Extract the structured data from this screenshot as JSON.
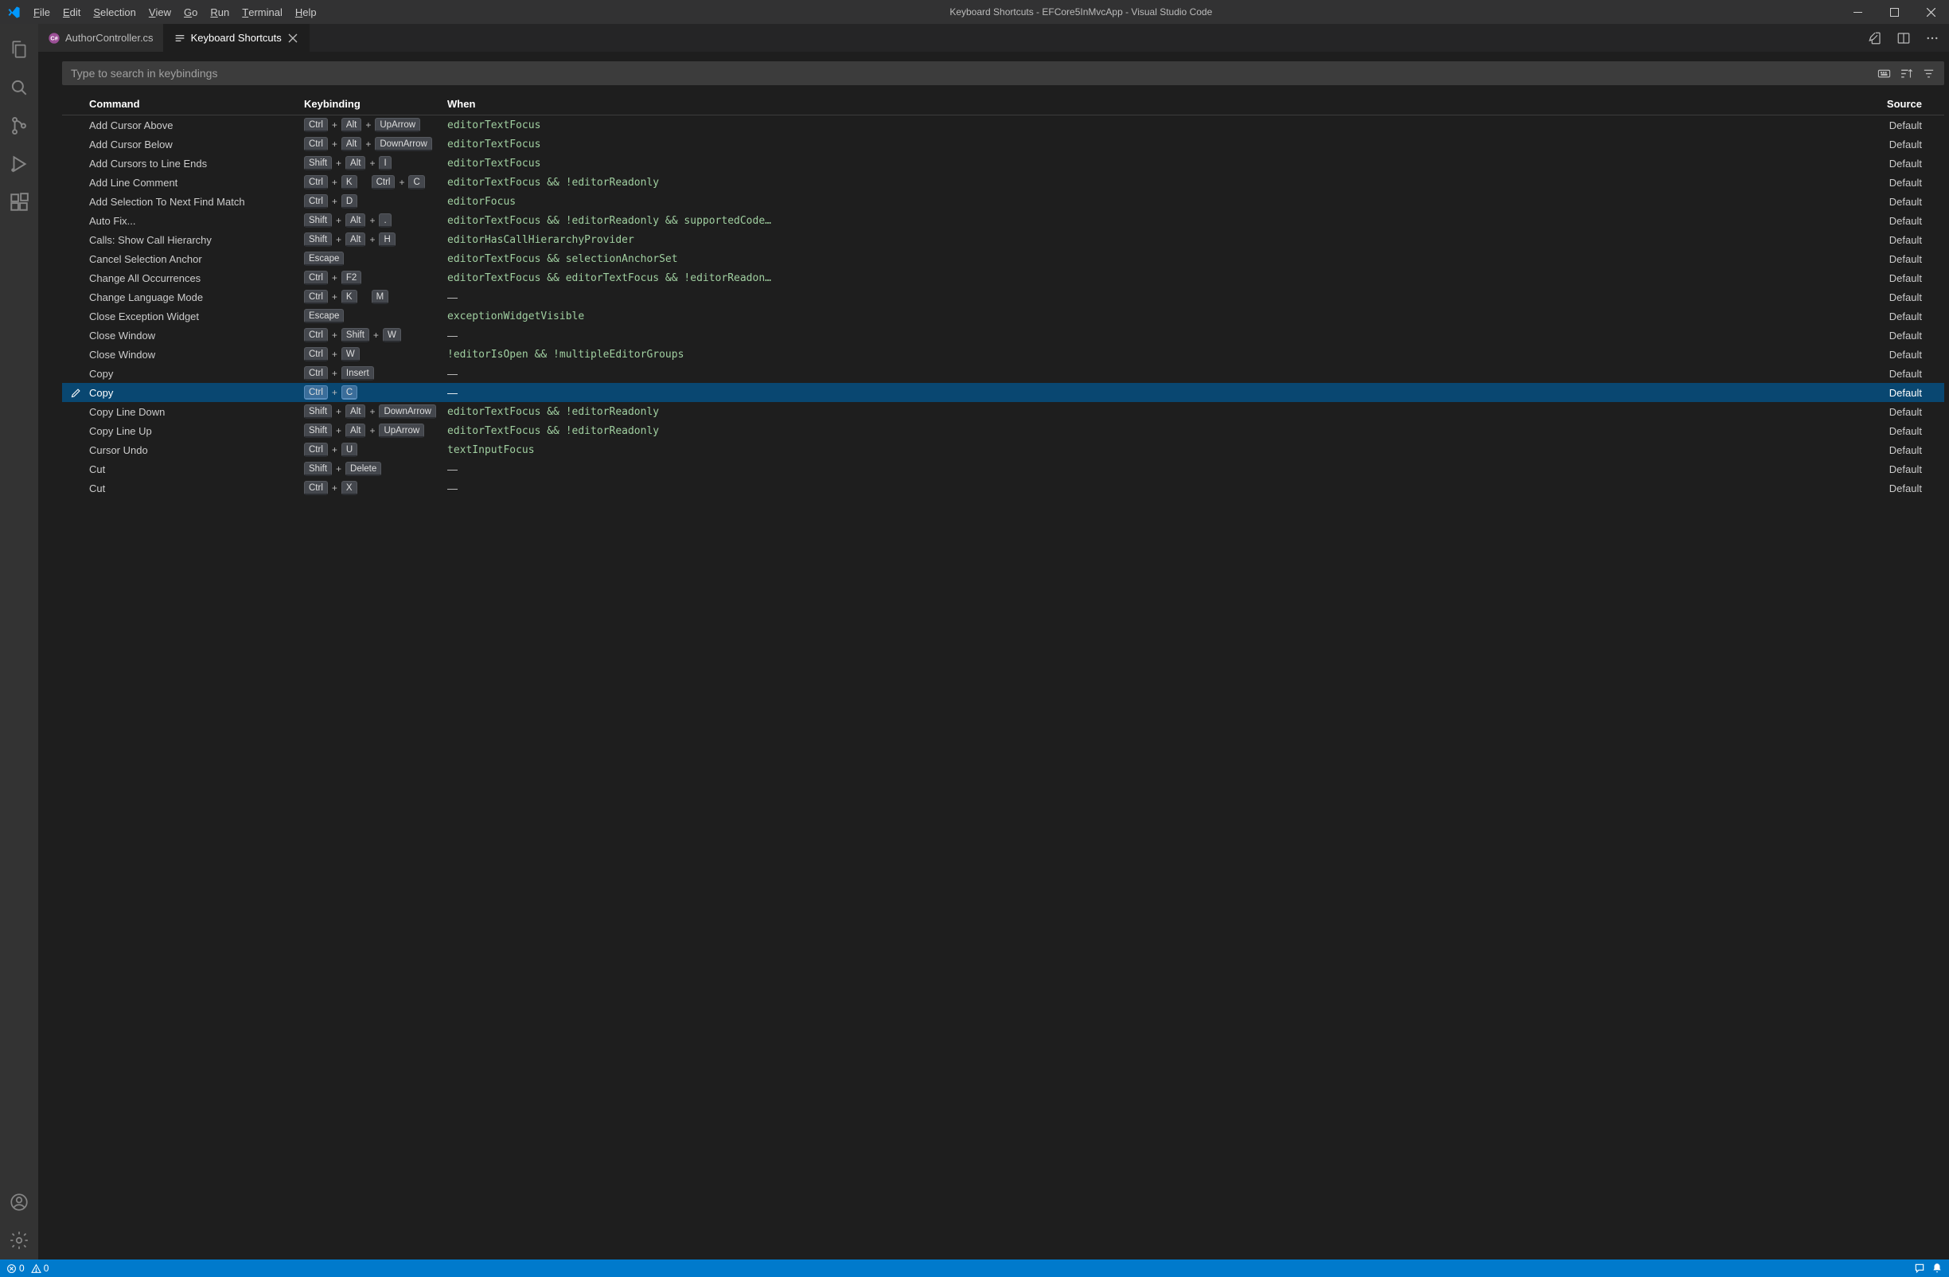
{
  "window": {
    "title": "Keyboard Shortcuts - EFCore5InMvcApp - Visual Studio Code"
  },
  "menu": {
    "items": [
      {
        "mn": "F",
        "rest": "ile"
      },
      {
        "mn": "E",
        "rest": "dit"
      },
      {
        "mn": "S",
        "rest": "election"
      },
      {
        "mn": "V",
        "rest": "iew"
      },
      {
        "mn": "G",
        "rest": "o"
      },
      {
        "mn": "R",
        "rest": "un"
      },
      {
        "mn": "T",
        "rest": "erminal"
      },
      {
        "mn": "H",
        "rest": "elp"
      }
    ]
  },
  "tabs": {
    "items": [
      {
        "label": "AuthorController.cs",
        "icon": "csharp",
        "active": false,
        "close": false
      },
      {
        "label": "Keyboard Shortcuts",
        "icon": "keybindings",
        "active": true,
        "close": true
      }
    ]
  },
  "search": {
    "placeholder": "Type to search in keybindings"
  },
  "columns": {
    "command": "Command",
    "keybinding": "Keybinding",
    "when": "When",
    "source": "Source"
  },
  "rows": [
    {
      "cmd": "Add Cursor Above",
      "keys": [
        [
          "Ctrl",
          "Alt",
          "UpArrow"
        ]
      ],
      "when": "editorTextFocus",
      "src": "Default"
    },
    {
      "cmd": "Add Cursor Below",
      "keys": [
        [
          "Ctrl",
          "Alt",
          "DownArrow"
        ]
      ],
      "when": "editorTextFocus",
      "src": "Default"
    },
    {
      "cmd": "Add Cursors to Line Ends",
      "keys": [
        [
          "Shift",
          "Alt",
          "I"
        ]
      ],
      "when": "editorTextFocus",
      "src": "Default"
    },
    {
      "cmd": "Add Line Comment",
      "keys": [
        [
          "Ctrl",
          "K"
        ],
        [
          "Ctrl",
          "C"
        ]
      ],
      "when": "editorTextFocus && !editorReadonly",
      "src": "Default"
    },
    {
      "cmd": "Add Selection To Next Find Match",
      "keys": [
        [
          "Ctrl",
          "D"
        ]
      ],
      "when": "editorFocus",
      "src": "Default"
    },
    {
      "cmd": "Auto Fix...",
      "keys": [
        [
          "Shift",
          "Alt",
          "."
        ]
      ],
      "when": "editorTextFocus && !editorReadonly && supportedCode…",
      "src": "Default"
    },
    {
      "cmd": "Calls: Show Call Hierarchy",
      "keys": [
        [
          "Shift",
          "Alt",
          "H"
        ]
      ],
      "when": "editorHasCallHierarchyProvider",
      "src": "Default"
    },
    {
      "cmd": "Cancel Selection Anchor",
      "keys": [
        [
          "Escape"
        ]
      ],
      "when": "editorTextFocus && selectionAnchorSet",
      "src": "Default"
    },
    {
      "cmd": "Change All Occurrences",
      "keys": [
        [
          "Ctrl",
          "F2"
        ]
      ],
      "when": "editorTextFocus && editorTextFocus && !editorReadon…",
      "src": "Default"
    },
    {
      "cmd": "Change Language Mode",
      "keys": [
        [
          "Ctrl",
          "K"
        ],
        [
          "M"
        ]
      ],
      "when": "—",
      "src": "Default"
    },
    {
      "cmd": "Close Exception Widget",
      "keys": [
        [
          "Escape"
        ]
      ],
      "when": "exceptionWidgetVisible",
      "src": "Default"
    },
    {
      "cmd": "Close Window",
      "keys": [
        [
          "Ctrl",
          "Shift",
          "W"
        ]
      ],
      "when": "—",
      "src": "Default"
    },
    {
      "cmd": "Close Window",
      "keys": [
        [
          "Ctrl",
          "W"
        ]
      ],
      "when": "!editorIsOpen && !multipleEditorGroups",
      "src": "Default"
    },
    {
      "cmd": "Copy",
      "keys": [
        [
          "Ctrl",
          "Insert"
        ]
      ],
      "when": "—",
      "src": "Default"
    },
    {
      "cmd": "Copy",
      "keys": [
        [
          "Ctrl",
          "C"
        ]
      ],
      "when": "—",
      "src": "Default",
      "selected": true
    },
    {
      "cmd": "Copy Line Down",
      "keys": [
        [
          "Shift",
          "Alt",
          "DownArrow"
        ]
      ],
      "when": "editorTextFocus && !editorReadonly",
      "src": "Default"
    },
    {
      "cmd": "Copy Line Up",
      "keys": [
        [
          "Shift",
          "Alt",
          "UpArrow"
        ]
      ],
      "when": "editorTextFocus && !editorReadonly",
      "src": "Default"
    },
    {
      "cmd": "Cursor Undo",
      "keys": [
        [
          "Ctrl",
          "U"
        ]
      ],
      "when": "textInputFocus",
      "src": "Default"
    },
    {
      "cmd": "Cut",
      "keys": [
        [
          "Shift",
          "Delete"
        ]
      ],
      "when": "—",
      "src": "Default"
    },
    {
      "cmd": "Cut",
      "keys": [
        [
          "Ctrl",
          "X"
        ]
      ],
      "when": "—",
      "src": "Default"
    }
  ],
  "status": {
    "errors": "0",
    "warnings": "0"
  }
}
